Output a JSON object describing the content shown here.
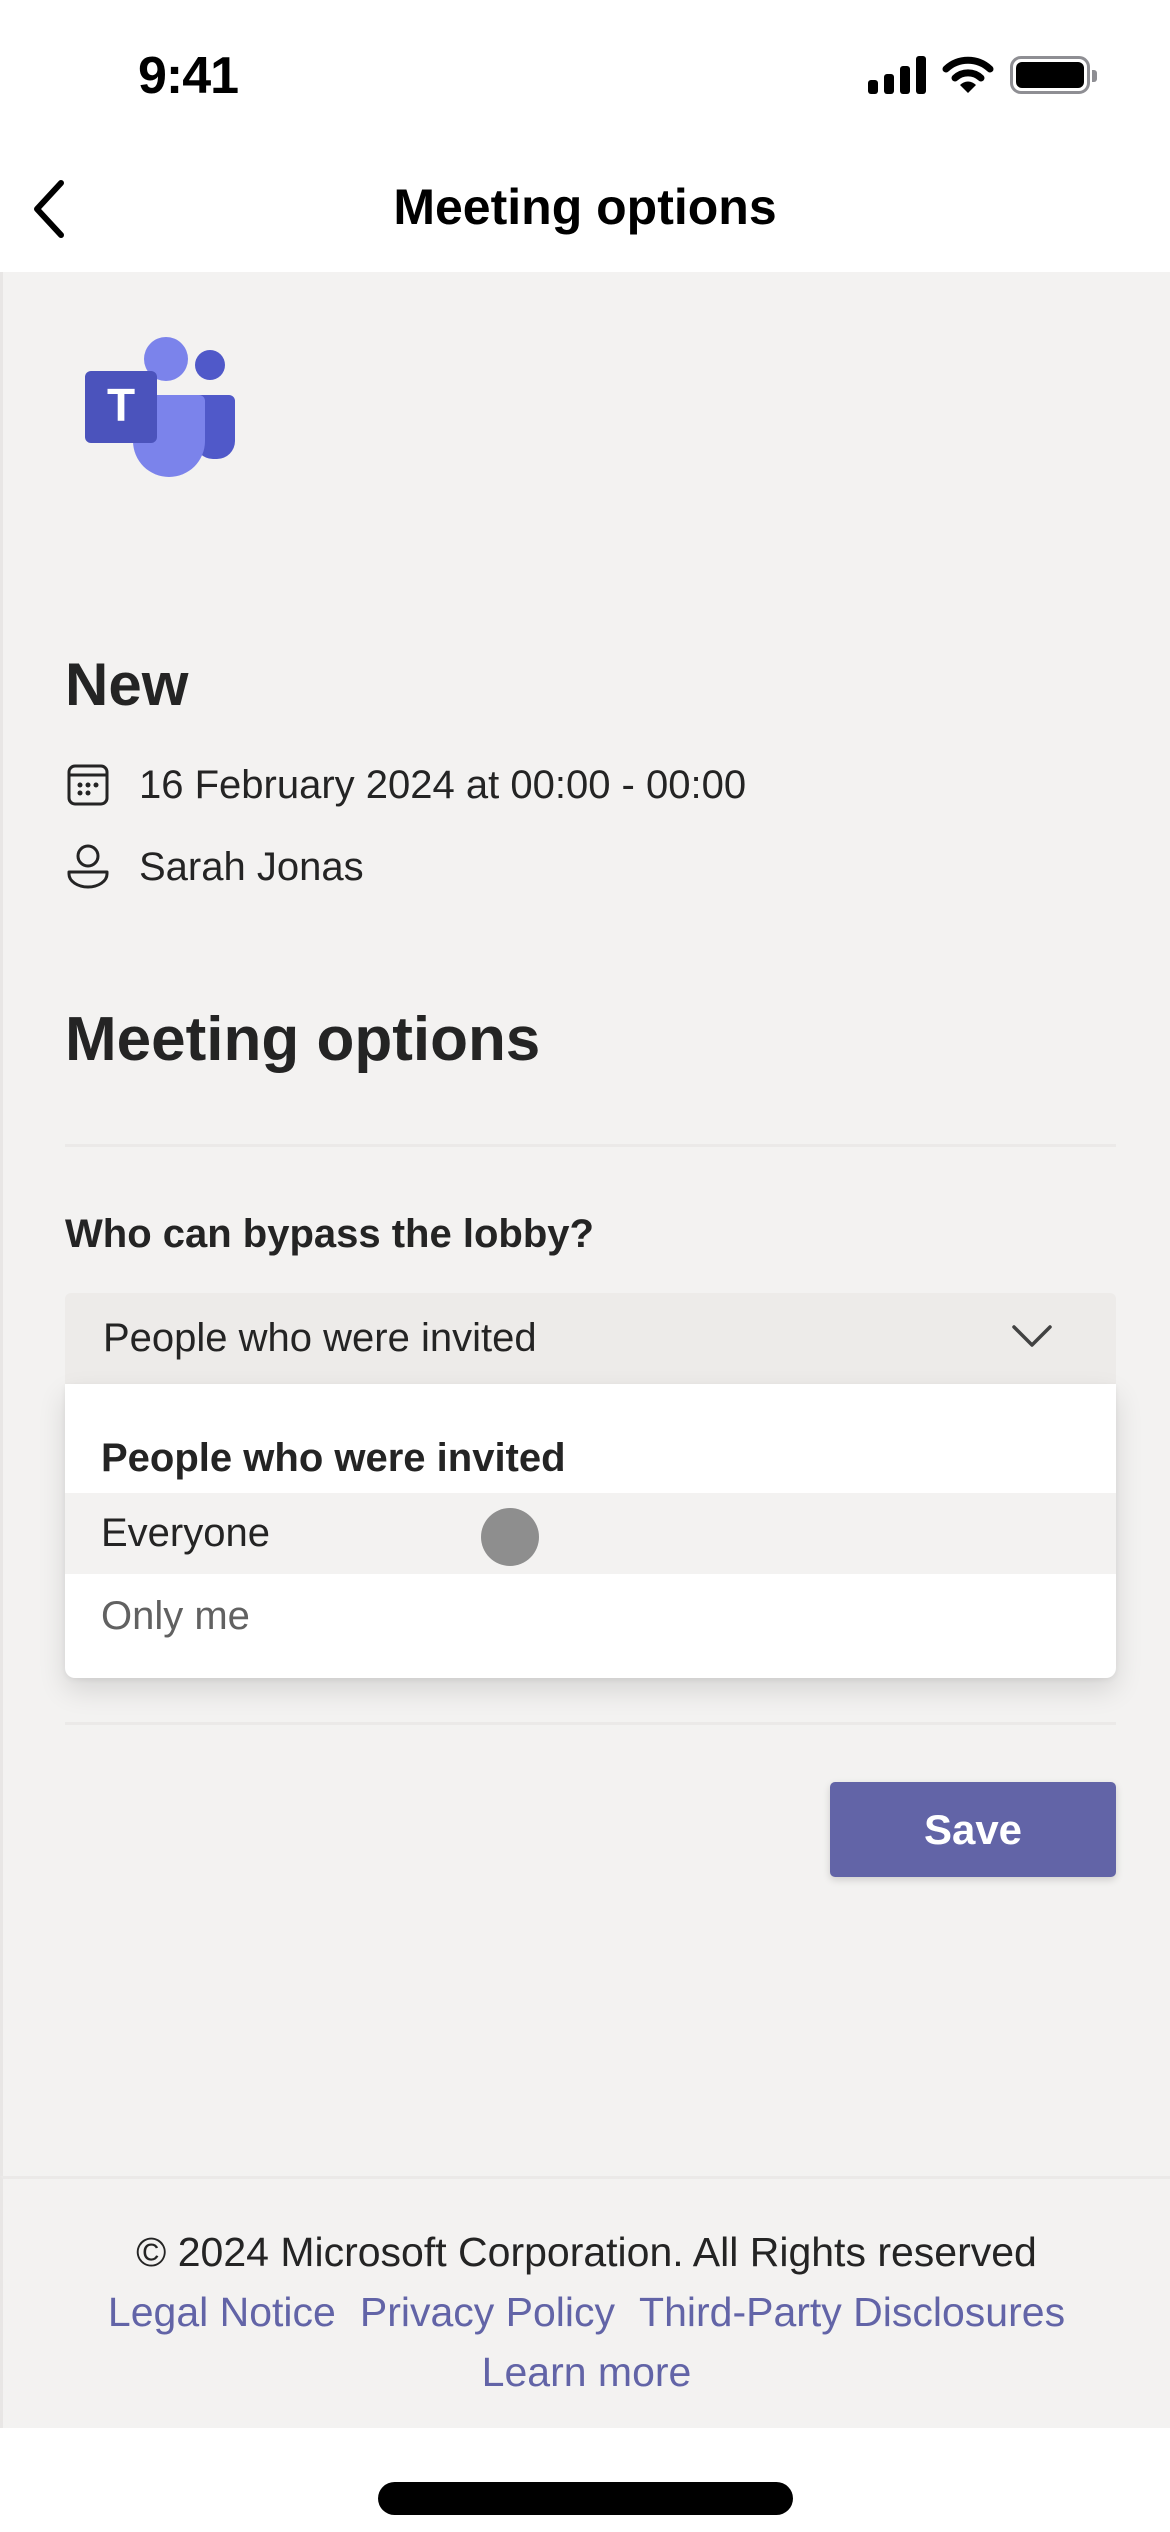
{
  "status_bar": {
    "time": "9:41",
    "icons": [
      "cellular-signal-icon",
      "wifi-icon",
      "battery-icon"
    ]
  },
  "nav": {
    "back_icon": "chevron-left-icon",
    "title": "Meeting options"
  },
  "app": {
    "logo": "microsoft-teams-logo"
  },
  "meeting": {
    "title": "New",
    "date_icon": "calendar-icon",
    "date_time": "16 February 2024 at 00:00 - 00:00",
    "organizer_icon": "person-icon",
    "organizer": "Sarah Jonas"
  },
  "options": {
    "heading": "Meeting options",
    "lobby_question": "Who can bypass the lobby?",
    "lobby_select": {
      "value": "People who were invited",
      "chevron_icon": "chevron-down-icon",
      "options": [
        {
          "label": "People who were invited",
          "state": "selected"
        },
        {
          "label": "Everyone",
          "state": "hovered"
        },
        {
          "label": "Only me",
          "state": "normal"
        }
      ]
    },
    "save_label": "Save"
  },
  "footer": {
    "copyright": "© 2024 Microsoft Corporation. All Rights reserved",
    "links": [
      "Legal Notice",
      "Privacy Policy",
      "Third-Party Disclosures"
    ],
    "learn_more": "Learn more"
  },
  "colors": {
    "brand": "#6264a7",
    "background": "#f3f2f1",
    "select_bg": "#edebe9",
    "text": "#242424",
    "muted_text": "#616161",
    "touch_indicator": "#8e8e8e"
  }
}
